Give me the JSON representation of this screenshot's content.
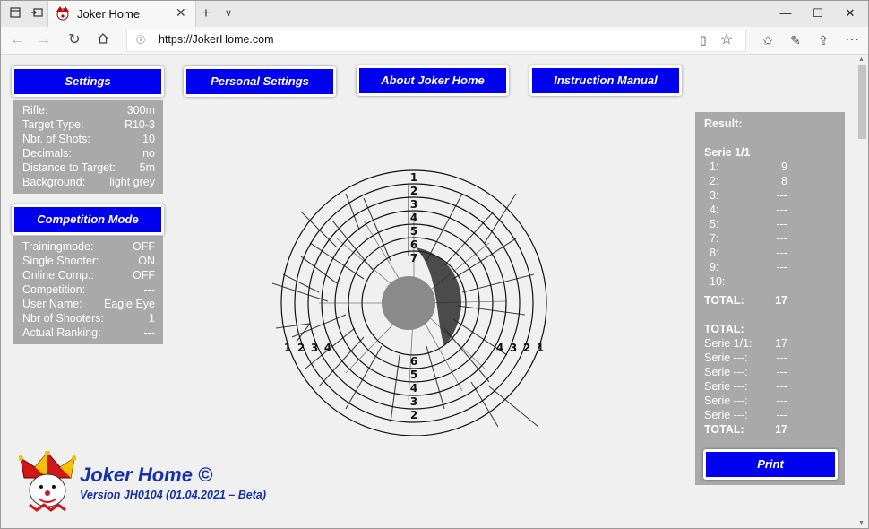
{
  "browser": {
    "tab_title": "Joker Home",
    "url": "https://JokerHome.com"
  },
  "menu": {
    "settings": "Settings",
    "personal_settings": "Personal Settings",
    "about": "About Joker Home",
    "manual": "Instruction Manual",
    "competition_mode": "Competition Mode",
    "print": "Print"
  },
  "settings_panel": [
    {
      "label": "Rifle:",
      "value": "300m"
    },
    {
      "label": "Target Type:",
      "value": "R10-3"
    },
    {
      "label": "Nbr. of Shots:",
      "value": "10"
    },
    {
      "label": "Decimals:",
      "value": "no"
    },
    {
      "label": "Distance to Target:",
      "value": "5m"
    },
    {
      "label": "Background:",
      "value": "light grey"
    }
  ],
  "competition_panel": [
    {
      "label": "Trainingmode:",
      "value": "OFF"
    },
    {
      "label": "Single Shooter:",
      "value": "ON"
    },
    {
      "label": "Online Comp.:",
      "value": "OFF"
    },
    {
      "label": "Competition:",
      "value": "---"
    },
    {
      "label": "User Name:",
      "value": "Eagle Eye"
    },
    {
      "label": "Nbr of Shooters:",
      "value": "1"
    },
    {
      "label": "Actual Ranking:",
      "value": "---"
    }
  ],
  "result": {
    "title": "Result:",
    "serie_header": "Serie 1/1",
    "shots": [
      {
        "n": "1:",
        "v": "9"
      },
      {
        "n": "2:",
        "v": "8"
      },
      {
        "n": "3:",
        "v": "---"
      },
      {
        "n": "4:",
        "v": "---"
      },
      {
        "n": "5:",
        "v": "---"
      },
      {
        "n": "7:",
        "v": "---"
      },
      {
        "n": "8:",
        "v": "---"
      },
      {
        "n": "9:",
        "v": "---"
      },
      {
        "n": "10:",
        "v": "---"
      }
    ],
    "total_label": "TOTAL:",
    "total_value": "17",
    "total2_label": "TOTAL:",
    "series": [
      {
        "n": "Serie 1/1:",
        "v": "17"
      },
      {
        "n": "Serie ---:",
        "v": "---"
      },
      {
        "n": "Serie ---:",
        "v": "---"
      },
      {
        "n": "Serie ---:",
        "v": "---"
      },
      {
        "n": "Serie ---:",
        "v": "---"
      },
      {
        "n": "Serie ---:",
        "v": "---"
      }
    ],
    "grand_total_label": "TOTAL:",
    "grand_total_value": "17"
  },
  "target": {
    "ring_numbers_top": [
      "1",
      "2",
      "3",
      "4",
      "5",
      "6",
      "7"
    ],
    "ring_numbers_bottom": [
      "6",
      "5",
      "4",
      "3",
      "2"
    ],
    "ring_numbers_left": [
      "1",
      "2",
      "3",
      "4"
    ],
    "ring_numbers_right": [
      "4",
      "3",
      "2",
      "1"
    ]
  },
  "footer": {
    "app_name": "Joker Home ©",
    "version": "Version JH0104 (01.04.2021 – Beta)"
  },
  "icons": [
    "tab-actions-icon",
    "tabs-aside-icon",
    "joker-favicon",
    "close-tab-icon",
    "new-tab-icon",
    "tab-list-icon",
    "minimize-icon",
    "maximize-icon",
    "close-window-icon",
    "back-icon",
    "forward-icon",
    "refresh-icon",
    "home-icon",
    "info-icon",
    "reading-view-icon",
    "favorite-star-icon",
    "favorites-icon",
    "pen-icon",
    "share-icon",
    "more-icon",
    "joker-logo"
  ],
  "colors": {
    "button_blue": "#0000f0",
    "panel_grey": "#a9a9a9",
    "logo_blue": "#1432a8"
  }
}
